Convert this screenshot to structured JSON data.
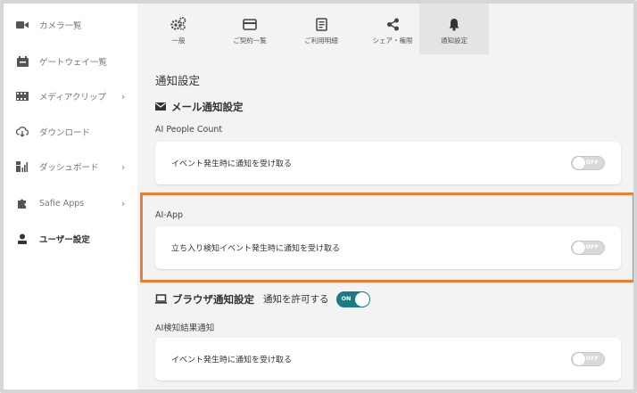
{
  "sidebar": {
    "items": [
      {
        "label": "カメラ一覧",
        "icon": "video-camera-icon",
        "chevron": ""
      },
      {
        "label": "ゲートウェイ一覧",
        "icon": "gateway-icon",
        "chevron": ""
      },
      {
        "label": "メディアクリップ",
        "icon": "film-icon",
        "chevron": "›"
      },
      {
        "label": "ダウンロード",
        "icon": "cloud-download-icon",
        "chevron": ""
      },
      {
        "label": "ダッシュボード",
        "icon": "dashboard-icon",
        "chevron": "›"
      },
      {
        "label": "Safie Apps",
        "icon": "puzzle-icon",
        "chevron": "›"
      },
      {
        "label": "ユーザー設定",
        "icon": "user-icon",
        "chevron": ""
      }
    ]
  },
  "tabs": [
    {
      "label": "一般",
      "icon": "gears-icon"
    },
    {
      "label": "ご契約一覧",
      "icon": "credit-card-icon"
    },
    {
      "label": "ご利用明細",
      "icon": "document-icon"
    },
    {
      "label": "シェア・権限",
      "icon": "share-icon"
    },
    {
      "label": "通知設定",
      "icon": "bell-icon"
    }
  ],
  "page": {
    "title": "通知設定",
    "mail_section_title": "メール通知設定",
    "sections": [
      {
        "label": "AI People Count",
        "card_text": "イベント発生時に通知を受け取る",
        "toggle": "OFF"
      },
      {
        "label": "AI-App",
        "card_text": "立ち入り検知イベント発生時に通知を受け取る",
        "toggle": "OFF"
      },
      {
        "label": "AI検知結果通知",
        "card_text": "イベント発生時に通知を受け取る",
        "toggle": "OFF"
      }
    ],
    "browser_title": "ブラウザ通知設定",
    "browser_permit": "通知を許可する",
    "browser_toggle": "ON"
  },
  "colors": {
    "accent_teal": "#1a7a86",
    "highlight_orange": "#ee7d31",
    "main_bg": "#f3f3f3"
  }
}
